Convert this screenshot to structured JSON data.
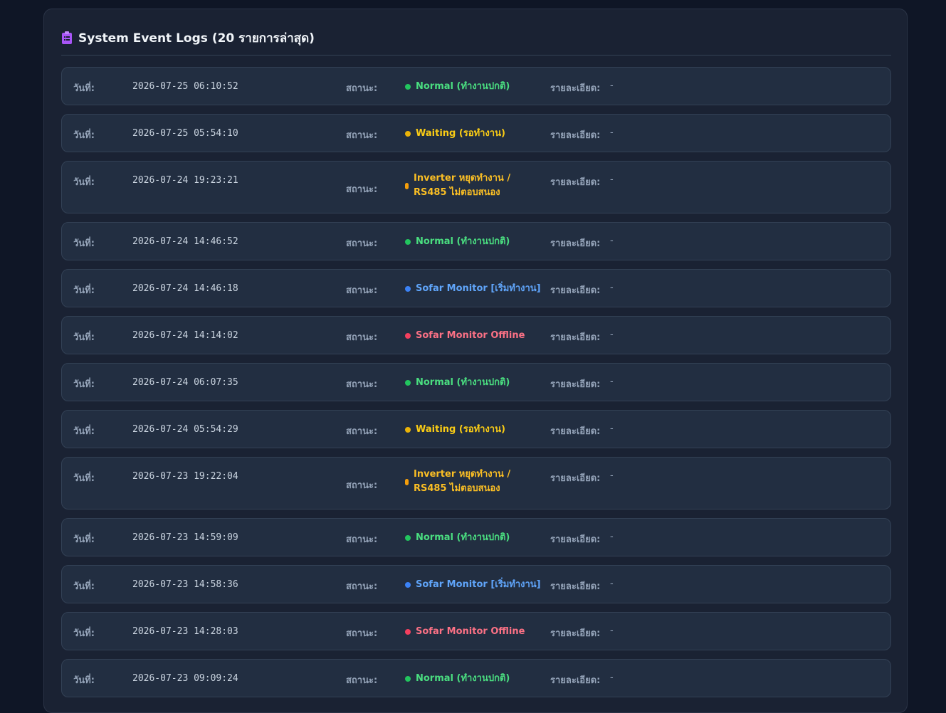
{
  "panel": {
    "title": "System Event Logs (20 รายการล่าสุด)",
    "title_icon": "clipboard-list-icon",
    "accent_color": "#a855f7"
  },
  "labels": {
    "date": "วันที่:",
    "status": "สถานะ:",
    "detail": "รายละเอียด:"
  },
  "status_colors": {
    "normal": "#22c55e",
    "waiting": "#eab308",
    "fault": "#f59e0b",
    "start": "#3b82f6",
    "offline": "#f43f5e"
  },
  "logs": [
    {
      "date": "2026-07-25 06:10:52",
      "status": "Normal (ทำงานปกติ)",
      "kind": "normal",
      "detail": "-"
    },
    {
      "date": "2026-07-25 05:54:10",
      "status": "Waiting (รอทำงาน)",
      "kind": "waiting",
      "detail": "-"
    },
    {
      "date": "2026-07-24 19:23:21",
      "status": "Inverter หยุดทำงาน /\nRS485 ไม่ตอบสนอง",
      "kind": "fault",
      "detail": "-"
    },
    {
      "date": "2026-07-24 14:46:52",
      "status": "Normal (ทำงานปกติ)",
      "kind": "normal",
      "detail": "-"
    },
    {
      "date": "2026-07-24 14:46:18",
      "status": "Sofar Monitor [เริ่มทำงาน]",
      "kind": "start",
      "detail": "-"
    },
    {
      "date": "2026-07-24 14:14:02",
      "status": "Sofar Monitor Offline",
      "kind": "offline",
      "detail": "-"
    },
    {
      "date": "2026-07-24 06:07:35",
      "status": "Normal (ทำงานปกติ)",
      "kind": "normal",
      "detail": "-"
    },
    {
      "date": "2026-07-24 05:54:29",
      "status": "Waiting (รอทำงาน)",
      "kind": "waiting",
      "detail": "-"
    },
    {
      "date": "2026-07-23 19:22:04",
      "status": "Inverter หยุดทำงาน /\nRS485 ไม่ตอบสนอง",
      "kind": "fault",
      "detail": "-"
    },
    {
      "date": "2026-07-23 14:59:09",
      "status": "Normal (ทำงานปกติ)",
      "kind": "normal",
      "detail": "-"
    },
    {
      "date": "2026-07-23 14:58:36",
      "status": "Sofar Monitor [เริ่มทำงาน]",
      "kind": "start",
      "detail": "-"
    },
    {
      "date": "2026-07-23 14:28:03",
      "status": "Sofar Monitor Offline",
      "kind": "offline",
      "detail": "-"
    },
    {
      "date": "2026-07-23 09:09:24",
      "status": "Normal (ทำงานปกติ)",
      "kind": "normal",
      "detail": "-"
    }
  ]
}
